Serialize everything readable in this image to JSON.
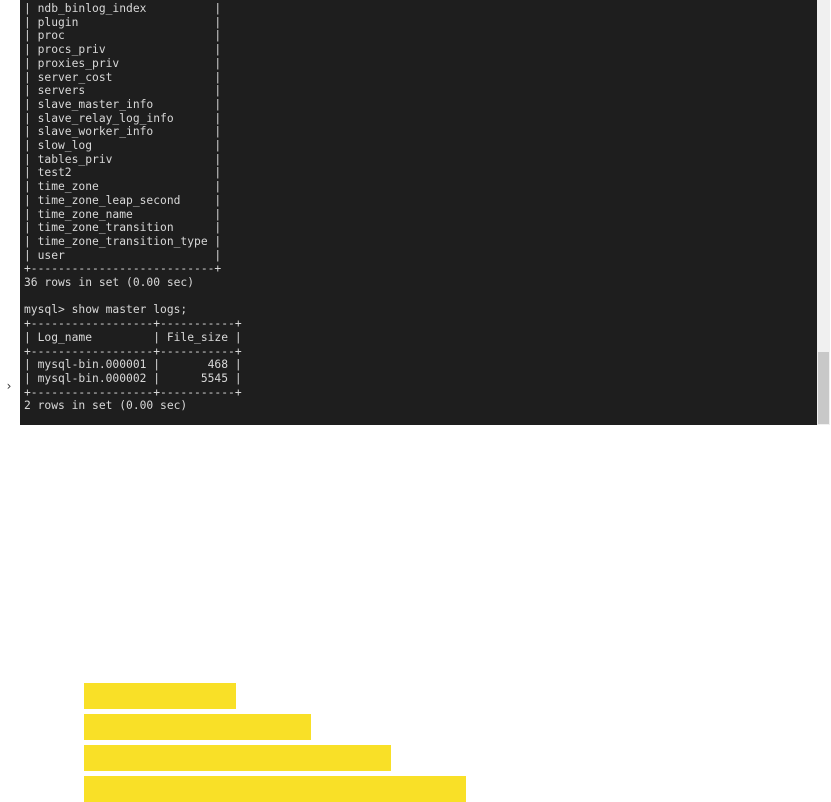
{
  "terminal": {
    "lines": [
      "| ndb_binlog_index          |",
      "| plugin                    |",
      "| proc                      |",
      "| procs_priv                |",
      "| proxies_priv              |",
      "| server_cost               |",
      "| servers                   |",
      "| slave_master_info         |",
      "| slave_relay_log_info      |",
      "| slave_worker_info         |",
      "| slow_log                  |",
      "| tables_priv               |",
      "| test2                     |",
      "| time_zone                 |",
      "| time_zone_leap_second     |",
      "| time_zone_name            |",
      "| time_zone_transition      |",
      "| time_zone_transition_type |",
      "| user                      |",
      "+---------------------------+",
      "36 rows in set (0.00 sec)",
      "",
      "mysql> show master logs;",
      "+------------------+-----------+",
      "| Log_name         | File_size |",
      "+------------------+-----------+",
      "| mysql-bin.000001 |       468 |",
      "| mysql-bin.000002 |      5545 |",
      "+------------------+-----------+",
      "2 rows in set (0.00 sec)"
    ]
  },
  "icons": {
    "expand": "chevron-right-icon",
    "expand_glyph": "›"
  },
  "colors": {
    "terminal_bg": "#1e1e1e",
    "terminal_fg": "#d8d8d8",
    "highlight": "#f9e027"
  }
}
